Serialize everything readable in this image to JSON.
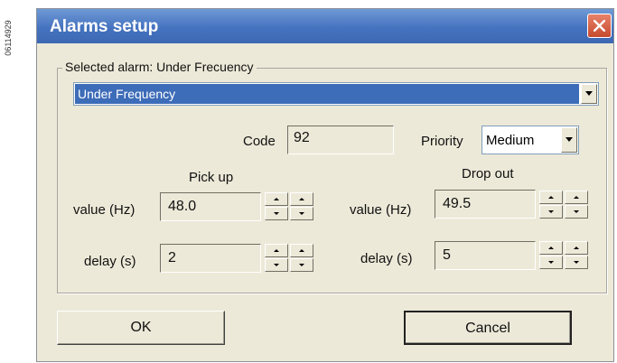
{
  "figure_id": "06114929",
  "window": {
    "title": "Alarms setup"
  },
  "group": {
    "legend": "Selected alarm: Under Frecuency"
  },
  "alarm_select": {
    "value": "Under Frequency"
  },
  "code": {
    "label": "Code",
    "value": "92"
  },
  "priority": {
    "label": "Priority",
    "value": "Medium"
  },
  "pickup": {
    "header": "Pick up",
    "value_label": "value (Hz)",
    "value": "48.0",
    "delay_label": "delay (s)",
    "delay": "2"
  },
  "dropout": {
    "header": "Drop out",
    "value_label": "value (Hz)",
    "value": "49.5",
    "delay_label": "delay (s)",
    "delay": "5"
  },
  "buttons": {
    "ok": "OK",
    "cancel": "Cancel"
  },
  "icons": {
    "close": "close-icon",
    "dropdown": "chevron-down-icon",
    "spin_up": "arrow-up-icon",
    "spin_down": "arrow-down-icon"
  },
  "colors": {
    "title_bar": "#4573bf",
    "close_button": "#d25c3f",
    "selection": "#3d6cb8",
    "dialog_bg": "#ece9d8"
  }
}
